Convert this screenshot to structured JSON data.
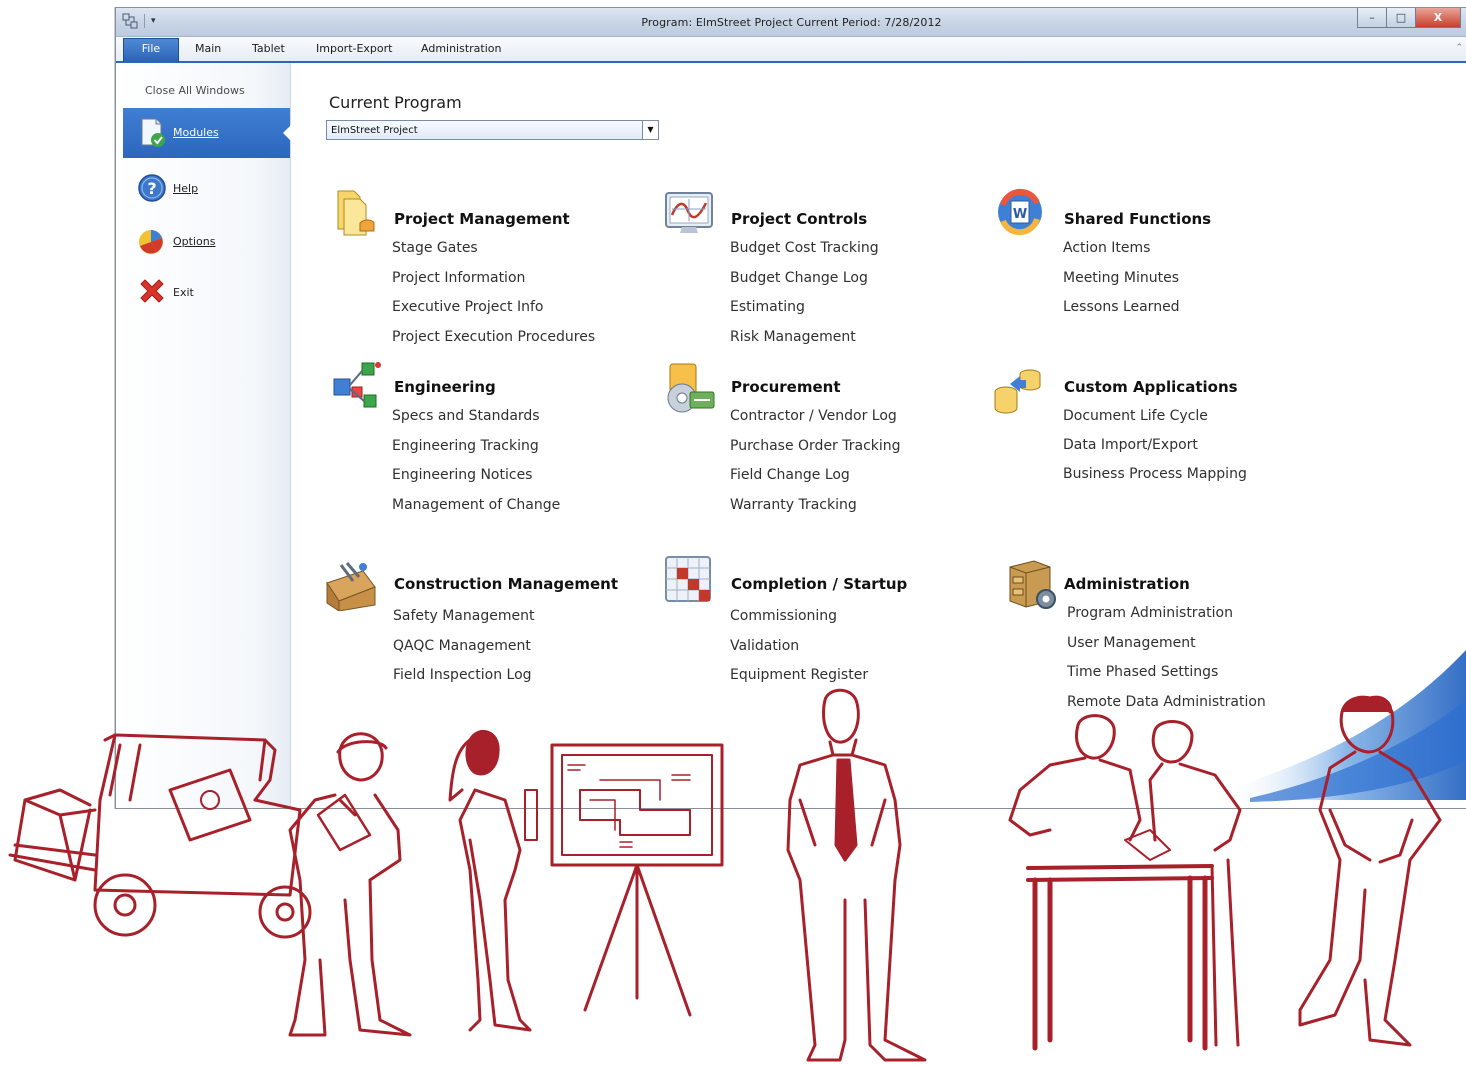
{
  "window": {
    "title": "Program: ElmStreet Project Current Period: 7/28/2012",
    "minimize_glyph": "–",
    "maximize_glyph": "□",
    "close_glyph": "X"
  },
  "ribbon": {
    "tabs": [
      "File",
      "Main",
      "Tablet",
      "Import-Export",
      "Administration"
    ]
  },
  "backstage": {
    "close_all": "Close All Windows",
    "items": [
      {
        "label": "Modules",
        "icon": "modules-icon",
        "selected": true
      },
      {
        "label": "Help",
        "icon": "help-icon"
      },
      {
        "label": "Options",
        "icon": "options-icon"
      },
      {
        "label": "Exit",
        "icon": "exit-icon"
      }
    ]
  },
  "current_program": {
    "label": "Current Program",
    "value": "ElmStreet Project"
  },
  "modules": [
    {
      "title": "Project Management",
      "icon": "folders-icon",
      "items": [
        "Stage Gates",
        "Project Information",
        "Executive Project Info",
        "Project Execution Procedures"
      ]
    },
    {
      "title": "Project Controls",
      "icon": "chart-monitor-icon",
      "items": [
        "Budget Cost Tracking",
        "Budget Change Log",
        "Estimating",
        "Risk Management"
      ]
    },
    {
      "title": "Shared Functions",
      "icon": "office-sync-icon",
      "items": [
        "Action Items",
        "Meeting Minutes",
        "Lessons Learned"
      ]
    },
    {
      "title": "Engineering",
      "icon": "network-icon",
      "items": [
        "Specs and Standards",
        "Engineering Tracking",
        "Engineering Notices",
        "Management of Change"
      ]
    },
    {
      "title": "Procurement",
      "icon": "procurement-icon",
      "items": [
        "Contractor / Vendor Log",
        "Purchase Order Tracking",
        "Field Change Log",
        "Warranty Tracking"
      ]
    },
    {
      "title": "Custom Applications",
      "icon": "database-arrows-icon",
      "items": [
        "Document Life Cycle",
        "Data Import/Export",
        "Business Process Mapping"
      ]
    },
    {
      "title": "Construction Management",
      "icon": "toolbox-icon",
      "items": [
        "Safety Management",
        "QAQC Management",
        "Field Inspection Log"
      ]
    },
    {
      "title": "Completion / Startup",
      "icon": "grid-icon",
      "items": [
        "Commissioning",
        "Validation",
        "Equipment Register"
      ]
    },
    {
      "title": "Administration",
      "icon": "cabinet-gear-icon",
      "items": [
        "Program Administration",
        "User Management",
        "Time Phased Settings",
        "Remote Data Administration"
      ]
    }
  ],
  "colors": {
    "accent": "#2e66b8",
    "illustration": "#a8202a"
  }
}
